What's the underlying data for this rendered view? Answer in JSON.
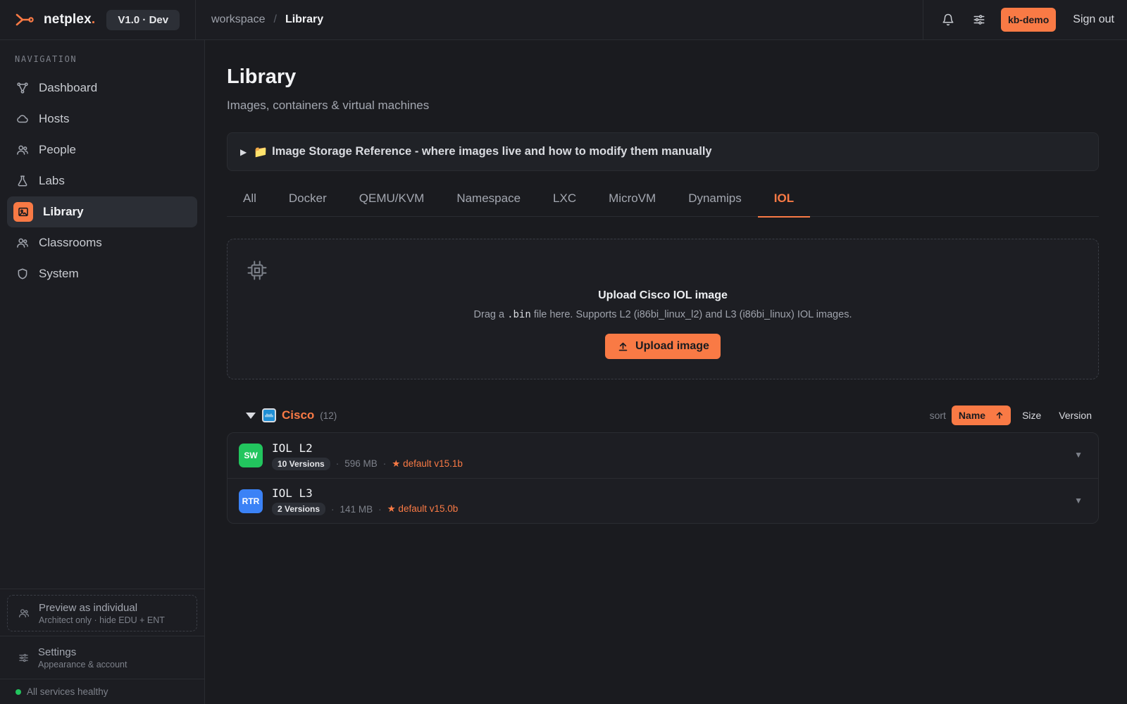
{
  "brand": {
    "name": "netplex",
    "dot": ".",
    "version": "V1.0 · Dev"
  },
  "breadcrumb": {
    "workspace": "workspace",
    "separator": "/",
    "current": "Library"
  },
  "header": {
    "user": "kb-demo",
    "sign_out": "Sign out"
  },
  "sidebar": {
    "heading": "NAVIGATION",
    "items": [
      {
        "label": "Dashboard",
        "icon": "dashboard-icon"
      },
      {
        "label": "Hosts",
        "icon": "cloud-icon"
      },
      {
        "label": "People",
        "icon": "people-icon"
      },
      {
        "label": "Labs",
        "icon": "flask-icon"
      },
      {
        "label": "Library",
        "icon": "image-icon",
        "active": true
      },
      {
        "label": "Classrooms",
        "icon": "people-icon"
      },
      {
        "label": "System",
        "icon": "shield-icon"
      }
    ],
    "preview": {
      "title": "Preview as individual",
      "subtitle": "Architect only · hide EDU + ENT"
    },
    "settings": {
      "title": "Settings",
      "subtitle": "Appearance & account"
    },
    "health": "All services healthy"
  },
  "page": {
    "title": "Library",
    "subtitle": "Images, containers & virtual machines",
    "disclosure": "Image Storage Reference - where images live and how to modify them manually"
  },
  "tabs": [
    "All",
    "Docker",
    "QEMU/KVM",
    "Namespace",
    "LXC",
    "MicroVM",
    "Dynamips",
    "IOL"
  ],
  "active_tab": "IOL",
  "upload": {
    "title": "Upload Cisco IOL image",
    "desc_prefix": "Drag a",
    "desc_code": ".bin",
    "desc_suffix": "file here. Supports L2 (i86bi_linux_l2) and L3 (i86bi_linux) IOL images.",
    "button": "Upload image"
  },
  "group": {
    "vendor": "Cisco",
    "count": "(12)",
    "sort_label": "sort",
    "sort_options": [
      "Name",
      "Size",
      "Version"
    ],
    "sort_active": "Name"
  },
  "images": [
    {
      "badge": "SW",
      "badge_color": "#22c55e",
      "name": "IOL L2",
      "versions": "10 Versions",
      "size": "596 MB",
      "default": "★ default v15.1b"
    },
    {
      "badge": "RTR",
      "badge_color": "#3b82f6",
      "name": "IOL L3",
      "versions": "2 Versions",
      "size": "141 MB",
      "default": "★ default v15.0b"
    }
  ],
  "colors": {
    "accent": "#f97a45",
    "background": "#1a1b1f",
    "healthy": "#22c55e"
  }
}
